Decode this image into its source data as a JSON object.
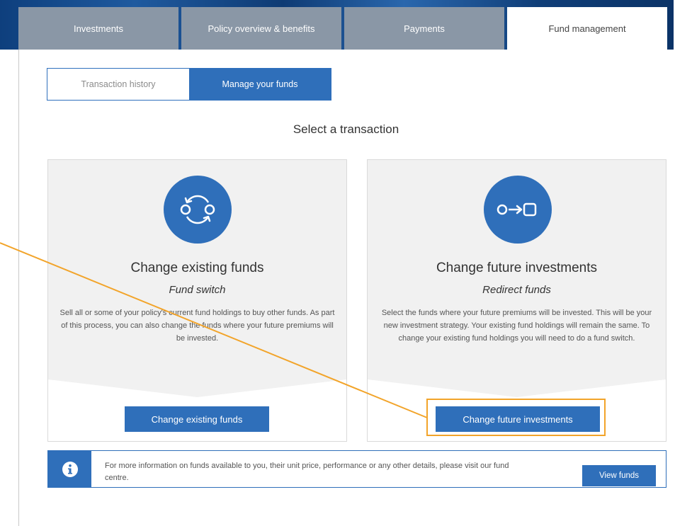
{
  "tabs": [
    {
      "label": "Investments"
    },
    {
      "label": "Policy overview & benefits"
    },
    {
      "label": "Payments"
    },
    {
      "label": "Fund management"
    }
  ],
  "segmented": {
    "transaction_history": "Transaction history",
    "manage_funds": "Manage your funds"
  },
  "heading": "Select a transaction",
  "cards": [
    {
      "title": "Change existing funds",
      "subtitle": "Fund switch",
      "description": "Sell all or some of your policy's current fund holdings to buy other funds. As part of this process, you can also change the funds where your future premiums will be invested.",
      "button": "Change existing funds",
      "icon": "switch-arrows-icon"
    },
    {
      "title": "Change future investments",
      "subtitle": "Redirect funds",
      "description": "Select the funds where your future premiums will be invested. This will be your new investment strategy. Your existing fund holdings will remain the same. To change your existing fund holdings you will need to do a fund switch.",
      "button": "Change future investments",
      "icon": "redirect-arrow-icon"
    }
  ],
  "info": {
    "icon": "info-icon",
    "text": "For more information on funds available to you, their unit price, performance or any other details, please visit our fund centre.",
    "button": "View funds"
  },
  "colors": {
    "primary": "#2f6fba",
    "highlight": "#f2a42a",
    "inactive_tab": "#8a97a6"
  }
}
